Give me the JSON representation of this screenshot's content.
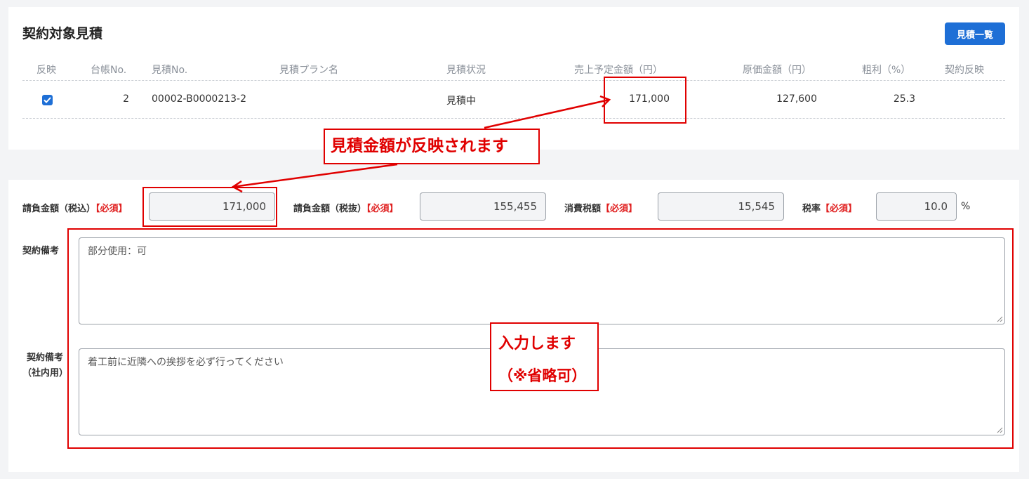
{
  "section": {
    "title": "契約対象見積",
    "button_label": "見積一覧"
  },
  "table": {
    "headers": [
      "反映",
      "台帳No.",
      "見積No.",
      "見積プラン名",
      "見積状況",
      "売上予定金額（円）",
      "原価金額（円）",
      "粗利（%）",
      "契約反映"
    ],
    "row": {
      "checked": true,
      "ledger_no": "2",
      "estimate_no": "00002-B0000213-2",
      "plan_name": "",
      "status": "見積中",
      "sales_amount": "171,000",
      "cost_amount": "127,600",
      "gross_margin": "25.3",
      "contract_reflect": ""
    }
  },
  "form": {
    "required_mark": "【必須】",
    "amount_incl_label": "請負金額（税込）",
    "amount_incl_value": "171,000",
    "amount_excl_label": "請負金額（税抜）",
    "amount_excl_value": "155,455",
    "tax_label": "消費税額",
    "tax_value": "15,545",
    "tax_rate_label": "税率",
    "tax_rate_value": "10.0",
    "tax_rate_unit": "%",
    "remarks_label": "契約備考",
    "remarks_value": "部分使用：可",
    "internal_remarks_label_1": "契約備考",
    "internal_remarks_label_2": "（社内用）",
    "internal_remarks_value": "着工前に近隣への挨拶を必ず行ってください"
  },
  "annotations": {
    "reflect_note": "見積金額が反映されます",
    "input_note_1": "入力します",
    "input_note_2": "（※省略可）",
    "color": "#e00000"
  },
  "colors": {
    "primary": "#1e6fd6",
    "required": "#e02020",
    "page_bg": "#f3f4f6"
  }
}
